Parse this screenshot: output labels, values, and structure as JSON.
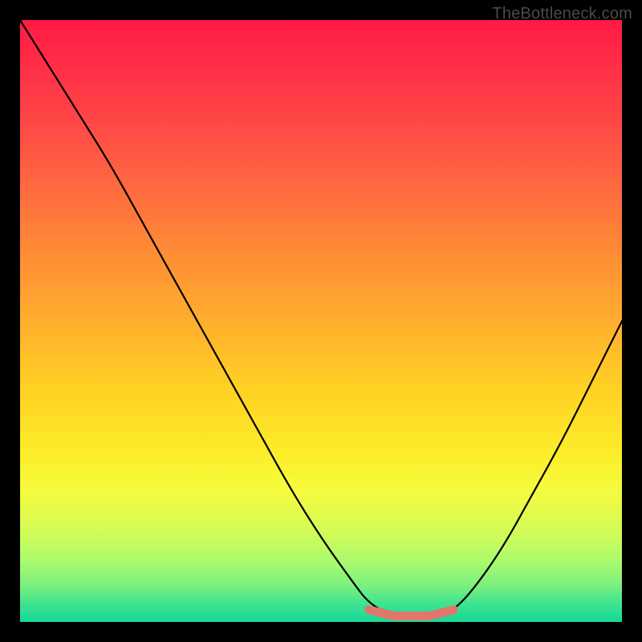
{
  "watermark": "TheBottleneck.com",
  "chart_data": {
    "type": "line",
    "title": "",
    "xlabel": "",
    "ylabel": "",
    "xlim": [
      0,
      100
    ],
    "ylim": [
      0,
      100
    ],
    "series": [
      {
        "name": "bottleneck-curve",
        "x": [
          0,
          5,
          10,
          15,
          20,
          25,
          30,
          35,
          40,
          45,
          50,
          55,
          58,
          62,
          66,
          70,
          72,
          75,
          80,
          85,
          90,
          95,
          100
        ],
        "values": [
          100,
          92,
          84,
          76,
          67,
          58,
          49,
          40,
          31,
          22,
          14,
          7,
          3,
          1,
          1,
          1,
          2,
          5,
          12,
          21,
          30,
          40,
          50
        ]
      },
      {
        "name": "optimal-band",
        "x": [
          58,
          60,
          62,
          64,
          66,
          68,
          70,
          72
        ],
        "values": [
          2,
          1.5,
          1,
          1,
          1,
          1,
          1.5,
          2
        ]
      }
    ],
    "gradient_stops": [
      {
        "pos": 0,
        "color": "#ff1a44"
      },
      {
        "pos": 18,
        "color": "#ff4b46"
      },
      {
        "pos": 38,
        "color": "#ff8a36"
      },
      {
        "pos": 62,
        "color": "#ffd324"
      },
      {
        "pos": 78,
        "color": "#f6fb3e"
      },
      {
        "pos": 90,
        "color": "#a9fb6e"
      },
      {
        "pos": 100,
        "color": "#14d99a"
      }
    ]
  }
}
